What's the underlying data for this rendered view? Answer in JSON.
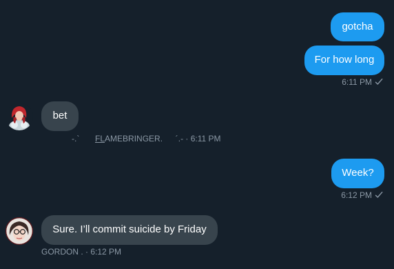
{
  "messages": [
    {
      "text": "gotcha"
    },
    {
      "text": "For how long",
      "time": "6:11 PM"
    },
    {
      "text": "bet",
      "sender_prefix": "-.`",
      "sender_u": "FL",
      "sender_rest": "AMEBRINGER.",
      "sender_suffix": "´.- · 6:11 PM"
    },
    {
      "text": "Week?",
      "time": "6:12 PM"
    },
    {
      "text": "Sure. I’ll commit suicide by Friday",
      "sender_meta": "GORDON . · 6:12 PM"
    }
  ],
  "icons": {
    "read_check": "check-icon",
    "avatar_1": "avatar-flamebringer",
    "avatar_2": "avatar-gordon"
  },
  "colors": {
    "background": "#15202b",
    "sent_bubble": "#1d9bf0",
    "received_bubble": "#38444d",
    "meta_text": "#8b98a5"
  }
}
